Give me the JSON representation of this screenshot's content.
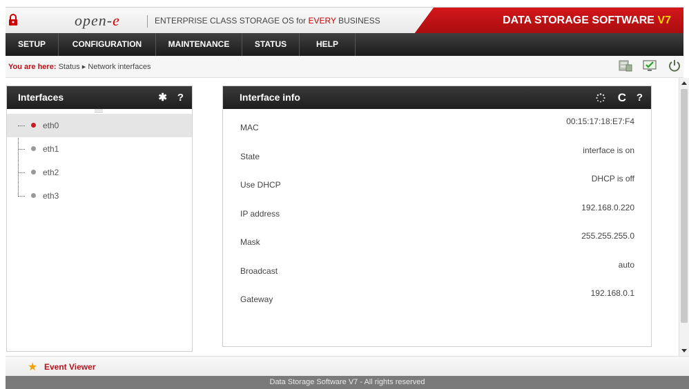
{
  "header": {
    "logo_text": "open-",
    "logo_e": "e",
    "tagline_pre": "ENTERPRISE CLASS STORAGE OS for ",
    "tagline_highlight": "EVERY",
    "tagline_post": " BUSINESS",
    "brand": "DATA STORAGE SOFTWARE ",
    "brand_version": "V7"
  },
  "menu": [
    "SETUP",
    "CONFIGURATION",
    "MAINTENANCE",
    "STATUS",
    "HELP"
  ],
  "breadcrumb": {
    "label": "You are here:",
    "path": "Status ▸ Network interfaces"
  },
  "interfaces_panel": {
    "title": "Interfaces",
    "settings_icon": "gear-icon",
    "help_icon": "?",
    "items": [
      {
        "label": "eth0",
        "selected": true
      },
      {
        "label": "eth1",
        "selected": false
      },
      {
        "label": "eth2",
        "selected": false
      },
      {
        "label": "eth3",
        "selected": false
      }
    ]
  },
  "info_panel": {
    "title": "Interface info",
    "help_icon": "?",
    "rows": [
      {
        "key": "MAC",
        "value": "00:15:17:18:E7:F4"
      },
      {
        "key": "State",
        "value": "interface is on"
      },
      {
        "key": "Use DHCP",
        "value": "DHCP is off"
      },
      {
        "key": "IP address",
        "value": "192.168.0.220"
      },
      {
        "key": "Mask",
        "value": "255.255.255.0"
      },
      {
        "key": "Broadcast",
        "value": "auto"
      },
      {
        "key": "Gateway",
        "value": "192.168.0.1"
      }
    ]
  },
  "event_viewer": {
    "label": "Event Viewer"
  },
  "footer": {
    "text": "Data Storage Software V7 - All rights reserved"
  },
  "colors": {
    "accent_red": "#c81d22",
    "menu_bg": "#1e1e1e",
    "selected_row": "#e5e5e5"
  }
}
